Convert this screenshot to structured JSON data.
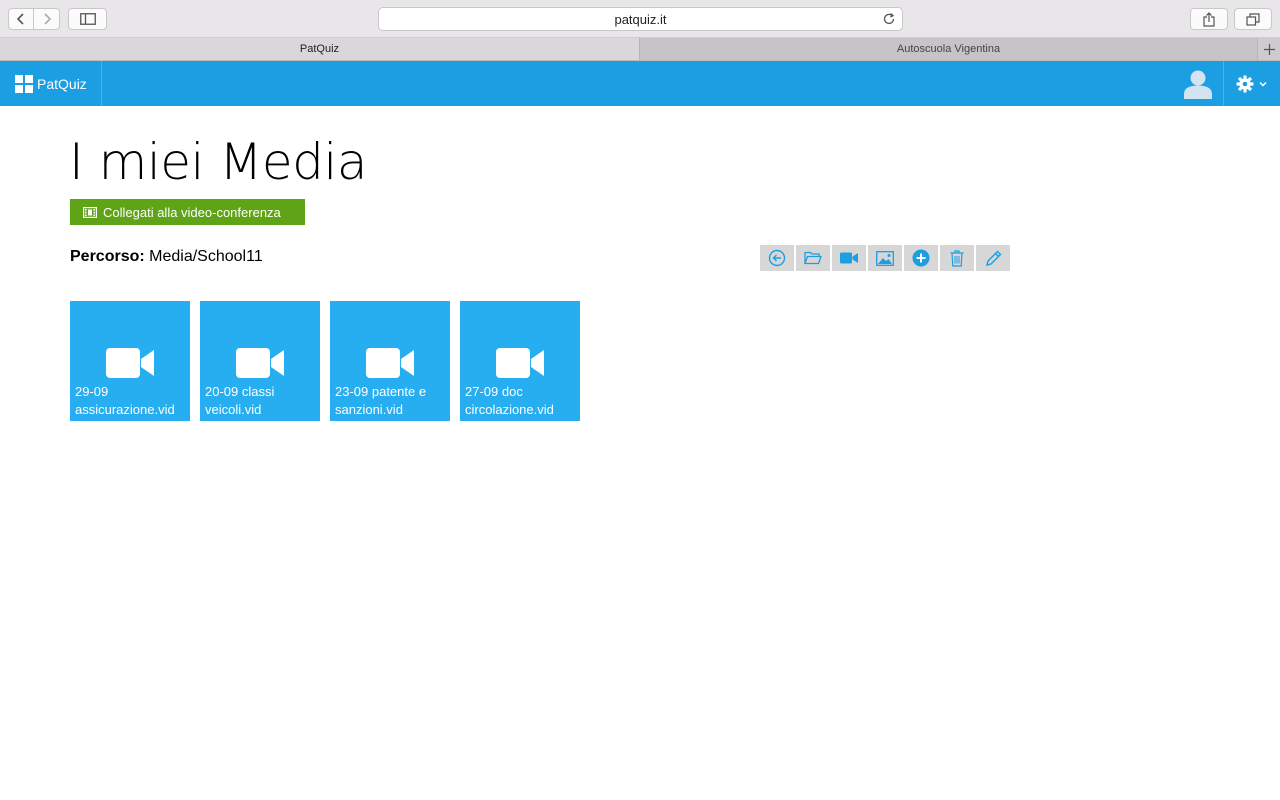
{
  "browser": {
    "url": "patquiz.it",
    "tabs": [
      {
        "label": "PatQuiz",
        "active": true
      },
      {
        "label": "Autoscuola Vigentina",
        "active": false
      }
    ]
  },
  "app": {
    "brand": "PatQuiz",
    "header_color": "#1c9ee2"
  },
  "page": {
    "title": "I miei Media",
    "conference_button": "Collegati alla video-conferenza",
    "path_label": "Percorso:",
    "path_value": "Media/School11"
  },
  "toolbar_actions": [
    {
      "icon": "back-arrow-icon",
      "name": "back"
    },
    {
      "icon": "folder-icon",
      "name": "folder"
    },
    {
      "icon": "video-camera-icon",
      "name": "video"
    },
    {
      "icon": "image-icon",
      "name": "image"
    },
    {
      "icon": "add-circle-icon",
      "name": "add"
    },
    {
      "icon": "trash-icon",
      "name": "delete"
    },
    {
      "icon": "pencil-icon",
      "name": "edit"
    }
  ],
  "media": [
    {
      "name": "29-09 assicurazione.vid",
      "icon": "video-camera-icon"
    },
    {
      "name": "20-09 classi veicoli.vid",
      "icon": "video-camera-icon"
    },
    {
      "name": "23-09 patente e sanzioni.vid",
      "icon": "video-camera-icon"
    },
    {
      "name": "27-09 doc circolazione.vid",
      "icon": "video-camera-icon"
    }
  ]
}
